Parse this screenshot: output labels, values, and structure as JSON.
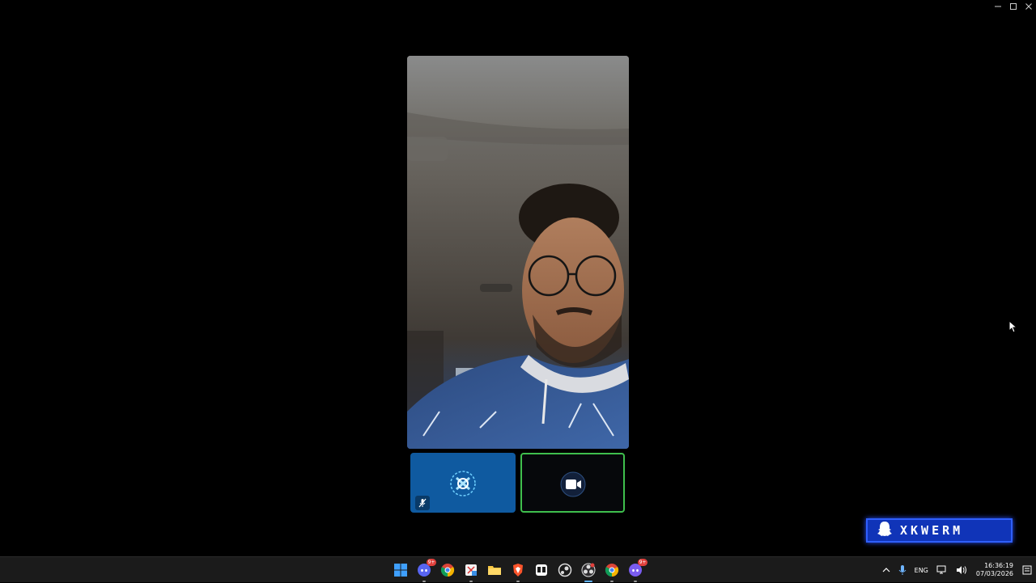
{
  "window": {
    "controls": [
      "minimize",
      "maximize",
      "close"
    ]
  },
  "call": {
    "main_video": "remote-participant-video",
    "tiles": [
      {
        "name": "self-tile",
        "state": "microphone muted",
        "accent": "#0f5aa0",
        "icon": "app-logo-icon"
      },
      {
        "name": "camera-tile",
        "state": "speaking",
        "accent": "#3fbf4d",
        "icon": "video-camera-icon"
      }
    ]
  },
  "watermark": {
    "text": "XKWERM",
    "icon": "snapchat-ghost-icon",
    "color": "#1034b8"
  },
  "taskbar": {
    "apps": [
      {
        "name": "start",
        "icon": "windows-start-icon"
      },
      {
        "name": "discord",
        "icon": "discord-icon",
        "badge": "9+"
      },
      {
        "name": "chrome",
        "icon": "chrome-icon"
      },
      {
        "name": "snipping-tool",
        "icon": "snip-icon"
      },
      {
        "name": "file-explorer",
        "icon": "folder-icon"
      },
      {
        "name": "brave",
        "icon": "brave-icon"
      },
      {
        "name": "roblox",
        "icon": "roblox-icon"
      },
      {
        "name": "steam",
        "icon": "steam-icon"
      },
      {
        "name": "obs",
        "icon": "obs-icon"
      },
      {
        "name": "chrome-profile",
        "icon": "chrome-icon"
      },
      {
        "name": "discord-ptb",
        "icon": "discord-icon",
        "badge": "9+"
      }
    ],
    "tray": {
      "language": "ENG",
      "time": "16:36:19",
      "date": "07/03/2026"
    }
  }
}
